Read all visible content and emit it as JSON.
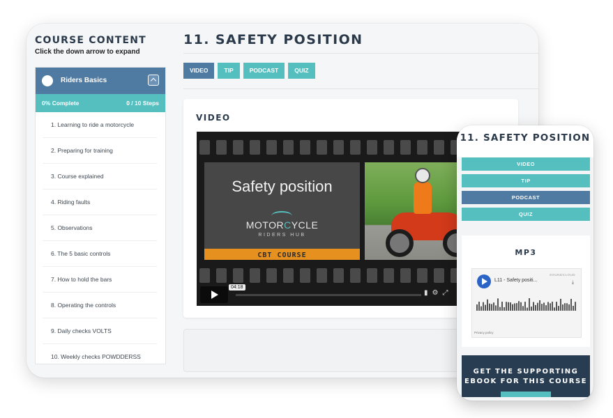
{
  "sidebar": {
    "title": "COURSE CONTENT",
    "subtitle": "Click the down arrow to expand",
    "section": {
      "name": "Riders Basics",
      "progress_label": "0% Complete",
      "steps_label": "0 / 10 Steps",
      "progress_fraction": 0
    },
    "lessons": [
      "1. Learning to ride a motorcycle",
      "2. Preparing for training",
      "3. Course explained",
      "4. Riding faults",
      "5. Observations",
      "6. The 5 basic controls",
      "7. How to hold the bars",
      "8. Operating the controls",
      "9. Daily checks VOLTS",
      "10. Weekly checks POWDDERSS"
    ]
  },
  "main": {
    "title": "11. SAFETY POSITION",
    "tabs": [
      {
        "label": "VIDEO",
        "active": true
      },
      {
        "label": "TIP",
        "active": false
      },
      {
        "label": "PODCAST",
        "active": false
      },
      {
        "label": "QUIZ",
        "active": false
      }
    ],
    "video": {
      "label": "VIDEO",
      "slide_title": "Safety position",
      "logo_text_a": "MOTOR",
      "logo_text_o": "C",
      "logo_text_b": "YCLE",
      "logo_sub": "RIDERS HUB",
      "banner": "CBT COURSE",
      "duration": "04:18"
    }
  },
  "phone": {
    "title": "11. SAFETY POSITION",
    "tabs": [
      {
        "label": "VIDEO",
        "active": false
      },
      {
        "label": "TIP",
        "active": false
      },
      {
        "label": "PODCAST",
        "active": true
      },
      {
        "label": "QUIZ",
        "active": false
      }
    ],
    "mp3": {
      "label": "MP3",
      "track": "L11 - Safety positi...",
      "brand": "SOUNDCLOUD",
      "privacy": "Privacy policy"
    },
    "ebook": {
      "line1": "GET THE SUPPORTING",
      "line2": "EBOOK FOR THIS COURSE"
    }
  },
  "colors": {
    "teal": "#55bfc0",
    "blue": "#4f7aa1",
    "navy": "#283d52",
    "orange": "#e6901f"
  }
}
